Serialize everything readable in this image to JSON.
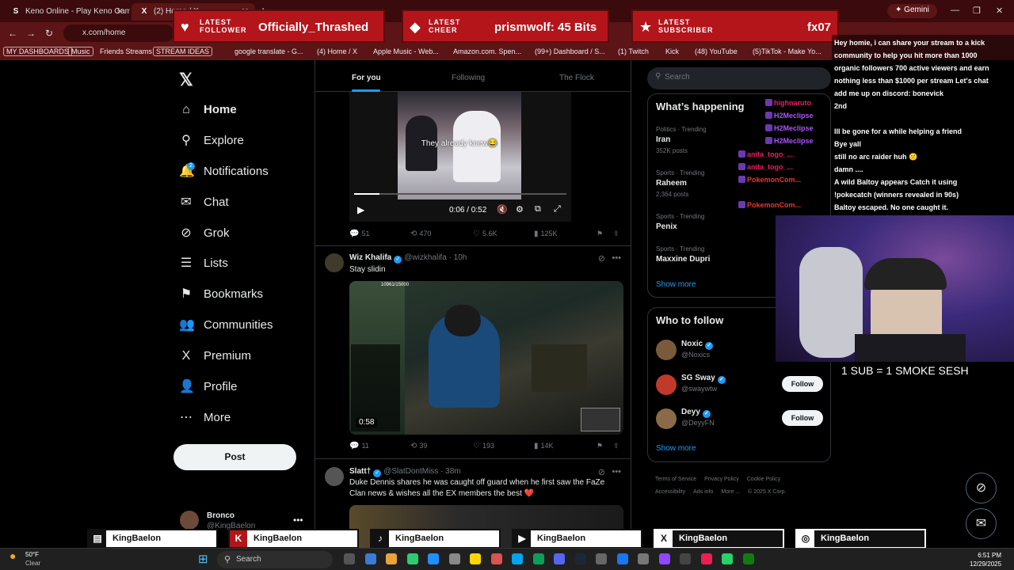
{
  "browser": {
    "tabs": [
      {
        "title": "Keno Online - Play Keno Game",
        "favicon": "S"
      },
      {
        "title": "(2) Home / X",
        "favicon": "X"
      }
    ],
    "gemini_label": "Gemini",
    "url": "x.com/home",
    "bookmarks": [
      "MY DASHBOARDS",
      "Music",
      "Friends Streams",
      "STREAM IDEAS",
      "google translate - G...",
      "(4) Home / X",
      "Apple Music - Web...",
      "Amazon.com. Spen...",
      "(99+) Dashboard / S...",
      "(1) Twitch",
      "Kick",
      "(48) YouTube",
      "(5)TikTok - Make Yo..."
    ]
  },
  "nav": {
    "items": [
      {
        "label": "Home",
        "icon": "home-icon",
        "glyph": "⌂"
      },
      {
        "label": "Explore",
        "icon": "search-icon",
        "glyph": "⚲"
      },
      {
        "label": "Notifications",
        "icon": "bell-icon",
        "glyph": "🔔"
      },
      {
        "label": "Chat",
        "icon": "mail-icon",
        "glyph": "✉"
      },
      {
        "label": "Grok",
        "icon": "grok-icon",
        "glyph": "⊘"
      },
      {
        "label": "Lists",
        "icon": "list-icon",
        "glyph": "☰"
      },
      {
        "label": "Bookmarks",
        "icon": "bookmark-icon",
        "glyph": "⚑"
      },
      {
        "label": "Communities",
        "icon": "communities-icon",
        "glyph": "👥"
      },
      {
        "label": "Premium",
        "icon": "x-premium-icon",
        "glyph": "X"
      },
      {
        "label": "Profile",
        "icon": "person-icon",
        "glyph": "👤"
      },
      {
        "label": "More",
        "icon": "more-circle-icon",
        "glyph": "⋯"
      }
    ],
    "notifications_badge": "2",
    "post_label": "Post",
    "account": {
      "name": "Bronco",
      "handle": "@KingBaelon"
    }
  },
  "feed": {
    "tabs": [
      "For you",
      "Following",
      "The Flock"
    ],
    "post1": {
      "caption": "They already knew😂",
      "video_time": "0:06 / 0:52",
      "replies": "51",
      "reposts": "470",
      "likes": "5.6K",
      "views": "125K"
    },
    "post2": {
      "name": "Wiz Khalifa",
      "handle": "@wizkhalifa",
      "time": "· 10h",
      "text": "Stay slidin",
      "video_overlay": "10961/15000",
      "video_time": "0:58",
      "replies": "11",
      "reposts": "39",
      "likes": "193",
      "views": "14K"
    },
    "post3": {
      "name": "Slatt†",
      "handle": "@SlatDontMiss",
      "time": "· 38m",
      "text": "Duke Dennis shares he was caught off guard when he first saw the FaZe Clan news & wishes all the EX members the best ❤️"
    }
  },
  "right": {
    "search_placeholder": "Search",
    "whats_happening": "What’s happening",
    "trends": [
      {
        "meta": "Politics · Trending",
        "name": "Iran",
        "count": "352K posts"
      },
      {
        "meta": "Sports · Trending",
        "name": "Raheem",
        "count": "2,364 posts"
      },
      {
        "meta": "Sports · Trending",
        "name": "Penix",
        "count": ""
      },
      {
        "meta": "Sports · Trending",
        "name": "Maxxine Dupri",
        "count": ""
      }
    ],
    "show_more": "Show more",
    "who_to_follow": "Who to follow",
    "suggestions": [
      {
        "name": "Noxic",
        "handle": "@Noxics",
        "follow": ""
      },
      {
        "name": "SG Sway",
        "handle": "@swaywtw",
        "follow": "Follow"
      },
      {
        "name": "Deyy",
        "handle": "@DeyyFN",
        "follow": "Follow"
      }
    ],
    "show_more_2": "Show more",
    "footer": [
      "Terms of Service",
      "Privacy Policy",
      "Cookie Policy",
      "Accessibility",
      "Ads info",
      "More ...",
      "© 2025 X Corp."
    ]
  },
  "overlay": {
    "follower": {
      "kind1": "LATEST",
      "kind2": "FOLLOWER",
      "name": "Officially_Thrashed"
    },
    "cheer": {
      "kind1": "LATEST",
      "kind2": "CHEER",
      "name": "prismwolf: 45 Bits"
    },
    "subscriber": {
      "kind1": "LATEST",
      "kind2": "SUBSCRIBER",
      "name": "fx07"
    },
    "chat_lines": [
      "Hey homie, i can share your stream to a kick",
      "community to help you hit more than 1000",
      "organic followers 700 active viewers and earn",
      "nothing less than $1000 per stream Let's chat",
      "add me up on discord: bonevick",
      "2nd",
      "",
      "Ill be gone for a while helping a friend",
      "Bye yall",
      "still no arc raider huh 😕",
      "damn ....",
      "A wild Baltoy appears  Catch it using",
      "!pokecatch (winners revealed in 90s)",
      "Baltoy escaped. No one caught it."
    ],
    "chat_users": [
      "highnaruto",
      "H2Meclipse",
      "H2Meclipse",
      "H2Meclipse",
      "anita_togo_...",
      "anita_togo_...",
      "PokemonCom...",
      "PokemonCom..."
    ],
    "webcam_caption": "1 SUB = 1 SMOKE SESH",
    "socials": [
      "KingBaelon",
      "KingBaelon",
      "KingBaelon",
      "KingBaelon",
      "KingBaelon",
      "KingBaelon"
    ]
  },
  "taskbar": {
    "temp": "50°F",
    "condition": "Clear",
    "search_label": "Search",
    "time": "6:51 PM",
    "date": "12/29/2025"
  }
}
